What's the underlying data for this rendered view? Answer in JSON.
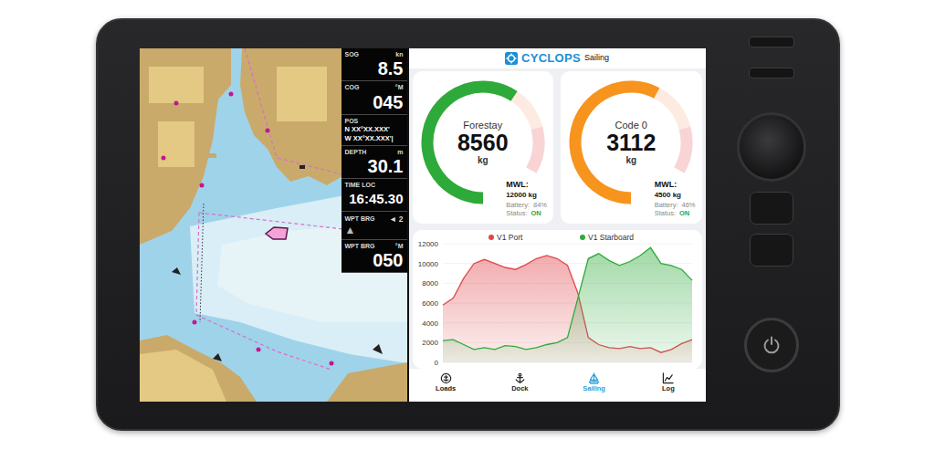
{
  "instruments": [
    {
      "kind": "value",
      "label": "SOG",
      "unit": "kn",
      "value": "8.5"
    },
    {
      "kind": "value",
      "label": "COG",
      "unit": "°M",
      "value": "045"
    },
    {
      "kind": "position",
      "label": "POS",
      "lines": [
        "N XX°XX.XXX'",
        "W XX°XX.XXX'|"
      ]
    },
    {
      "kind": "value",
      "label": "DEPTH",
      "unit": "m",
      "value": "30.1"
    },
    {
      "kind": "value",
      "label": "TIME LOC",
      "value": "16:45.30"
    },
    {
      "kind": "steer",
      "label": "WPT BRG",
      "value": "◄ 2",
      "arrow": "▲"
    },
    {
      "kind": "value",
      "label": "WPT BRG",
      "unit": "°M",
      "value": "050"
    }
  ],
  "app": {
    "brand": "CYCLOPS",
    "section": "Sailing"
  },
  "gauges": [
    {
      "name": "Forestay",
      "value": "8560",
      "unit": "kg",
      "level": 0.713,
      "color": "#2eaa3a",
      "mwl_label": "MWL:",
      "mwl": "12000 kg",
      "battery_label": "Battery:",
      "battery": "84%",
      "status_label": "Status:",
      "status": "ON",
      "status_on": true
    },
    {
      "name": "Code 0",
      "value": "3112",
      "unit": "kg",
      "level": 0.692,
      "color": "#f7941d",
      "mwl_label": "MWL:",
      "mwl": "4500 kg",
      "battery_label": "Battery:",
      "battery": "46%",
      "status_label": "Status:",
      "status": "ON",
      "status_on": true
    }
  ],
  "chart": {
    "y_max": 12000,
    "y_ticks": [
      "12000",
      "10000",
      "8000",
      "6000",
      "4000",
      "2000",
      "0"
    ],
    "series": [
      {
        "name": "V1 Port",
        "color": "#e0474c",
        "values": [
          5800,
          6500,
          8500,
          10000,
          10400,
          10000,
          9600,
          9400,
          9900,
          10500,
          10800,
          10500,
          9800,
          7000,
          2500,
          1800,
          1500,
          1400,
          1600,
          1400,
          1500,
          1000,
          1300,
          1900,
          2300
        ]
      },
      {
        "name": "V1 Starboard",
        "color": "#2eaa3a",
        "values": [
          2200,
          2300,
          1800,
          1300,
          1500,
          1300,
          1700,
          1600,
          1300,
          1500,
          1800,
          2000,
          2500,
          6500,
          10500,
          11000,
          10300,
          9800,
          10200,
          10800,
          11600,
          10000,
          9800,
          9400,
          8300
        ]
      }
    ]
  },
  "nav": [
    {
      "label": "Loads",
      "selected": false
    },
    {
      "label": "Dock",
      "selected": false
    },
    {
      "label": "Sailing",
      "selected": true
    },
    {
      "label": "Log",
      "selected": false
    }
  ]
}
